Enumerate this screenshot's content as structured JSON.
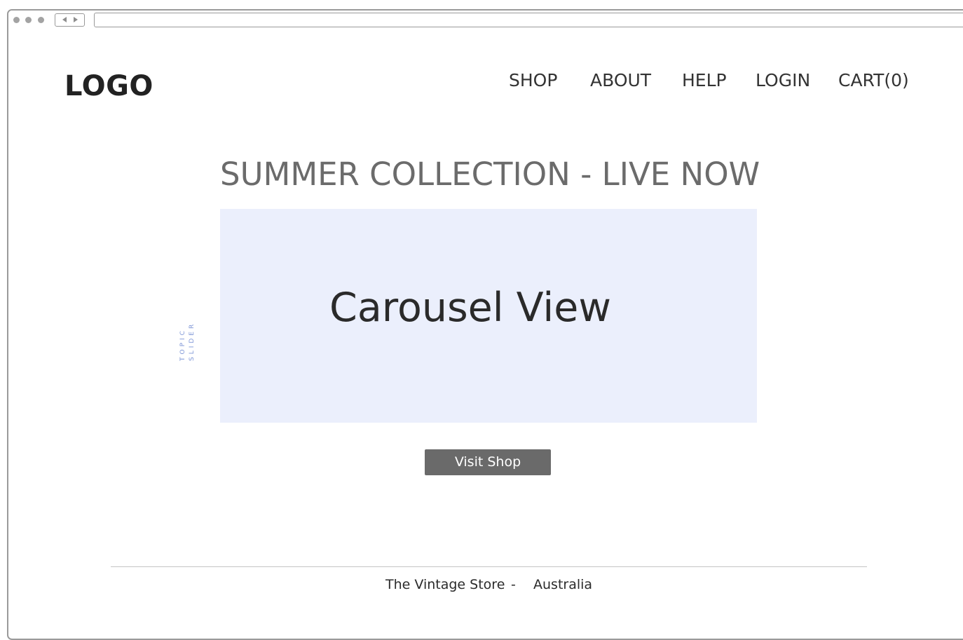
{
  "header": {
    "logo": "LOGO",
    "nav": [
      {
        "label": "SHOP"
      },
      {
        "label": "ABOUT"
      },
      {
        "label": "HELP"
      },
      {
        "label": "LOGIN"
      },
      {
        "label": "CART(0)"
      }
    ]
  },
  "hero": {
    "headline": "SUMMER COLLECTION - LIVE NOW",
    "carousel_label": "Carousel View",
    "side_label_line1": "TOPIC",
    "side_label_line2": "SLIDER",
    "cta_label": "Visit Shop"
  },
  "footer": {
    "store_name": "The Vintage Store",
    "separator": "-",
    "country": "Australia"
  },
  "colors": {
    "carousel_bg": "#ebeffc",
    "button_bg": "#6a6a6a",
    "headline": "#6b6b6b",
    "side_label": "#7d95d6"
  }
}
